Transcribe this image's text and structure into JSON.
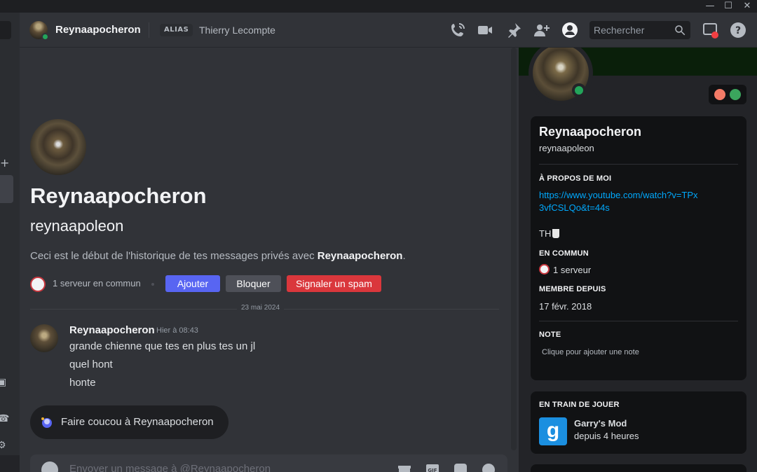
{
  "header": {
    "username": "Reynaapocheron",
    "alias_tag": "ALIAS",
    "alias_value": "Thierry Lecompte",
    "search_placeholder": "Rechercher",
    "icons": [
      "phone-call-icon",
      "video-call-icon",
      "pin-icon",
      "add-friend-icon",
      "user-profile-icon",
      "search-icon",
      "inbox-icon",
      "help-icon"
    ]
  },
  "window": {
    "controls": [
      "minimize",
      "maximize",
      "close"
    ]
  },
  "intro": {
    "display_name": "Reynaapocheron",
    "username": "reynaapoleon",
    "desc_prefix": "Ceci est le début de l'historique de tes messages privés avec ",
    "desc_name": "Reynaapocheron",
    "desc_suffix": ".",
    "mutual_servers": "1 serveur en commun",
    "btn_add": "Ajouter",
    "btn_block": "Bloquer",
    "btn_spam": "Signaler un spam"
  },
  "messages": {
    "date_divider": "23 mai 2024",
    "author": "Reynaapocheron",
    "timestamp": "Hier à 08:43",
    "lines": [
      "grande chienne que tes en plus tes un jl",
      "quel hont",
      "honte"
    ]
  },
  "wave": {
    "label": "Faire coucou à Reynaapocheron"
  },
  "composer": {
    "placeholder": "Envoyer un message à @Reynaapocheron",
    "icons": [
      "gift-icon",
      "gif-icon",
      "sticker-icon",
      "emoji-icon"
    ]
  },
  "profile": {
    "display_name": "Reynaapocheron",
    "username": "reynaapoleon",
    "about_label": "À PROPOS DE MOI",
    "about_link": "https://www.youtube.com/watch?v=TPx3vfCSLQo&t=44s",
    "about_text": "TH",
    "common_label": "EN COMMUN",
    "common_value": "1 serveur",
    "member_label": "MEMBRE DEPUIS",
    "member_value": "17 févr. 2018",
    "note_label": "NOTE",
    "note_placeholder": "Clique pour ajouter une note",
    "playing_label": "EN TRAIN DE JOUER",
    "game_name": "Garry's Mod",
    "game_time": "depuis 4 heures"
  },
  "colors": {
    "accent_blurple": "#5865f2",
    "danger_red": "#da373c",
    "online_green": "#23a55a",
    "link_blue": "#00a8fc"
  }
}
